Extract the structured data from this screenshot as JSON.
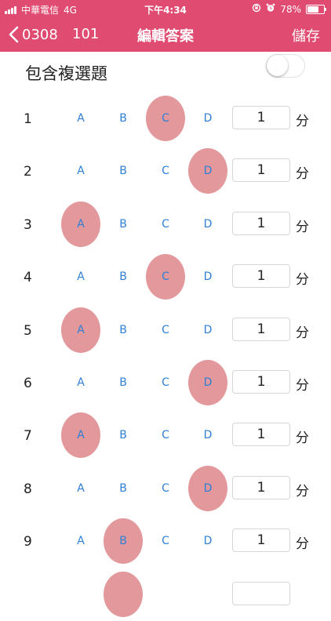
{
  "status_bar": {
    "carrier": "中華電信",
    "network": "4G",
    "time": "下午4:34",
    "battery": "78%",
    "battery_level": 0.78
  },
  "nav": {
    "back_label": "0308",
    "subtitle": "101",
    "title": "編輯答案",
    "save_label": "儲存"
  },
  "options": {
    "multi_select_label": "包含複選題",
    "multi_select_enabled": false
  },
  "choice_labels": [
    "A",
    "B",
    "C",
    "D"
  ],
  "unit_label": "分",
  "questions": [
    {
      "number": "1",
      "answer": "C",
      "score": "1"
    },
    {
      "number": "2",
      "answer": "D",
      "score": "1"
    },
    {
      "number": "3",
      "answer": "A",
      "score": "1"
    },
    {
      "number": "4",
      "answer": "C",
      "score": "1"
    },
    {
      "number": "5",
      "answer": "A",
      "score": "1"
    },
    {
      "number": "6",
      "answer": "D",
      "score": "1"
    },
    {
      "number": "7",
      "answer": "A",
      "score": "1"
    },
    {
      "number": "8",
      "answer": "D",
      "score": "1"
    },
    {
      "number": "9",
      "answer": "B",
      "score": "1"
    },
    {
      "number": "",
      "answer": "B",
      "score": ""
    }
  ],
  "colors": {
    "header": "#e04b72",
    "selected_bubble": "#e3989b",
    "choice_text": "#2e7fd6"
  }
}
